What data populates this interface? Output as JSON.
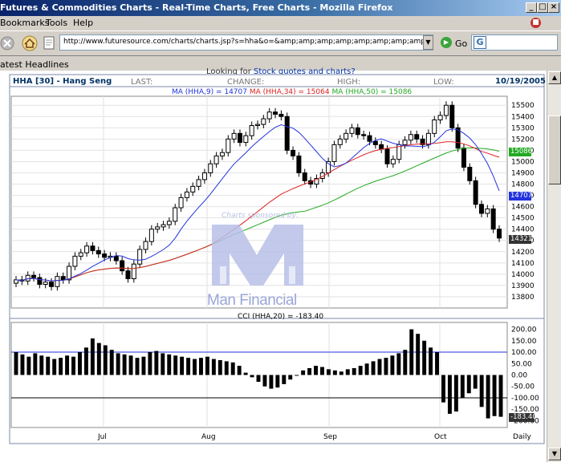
{
  "window": {
    "title": "Futures & Commodities Charts - Real-Time Charts, Free Charts - Mozilla Firefox"
  },
  "menu": {
    "bookmarks": "Bookmarks",
    "tools": "Tools",
    "help": "Help"
  },
  "nav": {
    "url": "http://www.futuresource.com/charts/charts.jsp?s=hha&o=&amp;amp;amp;amp;amp;amp;amp;amp;amp;a=D&a",
    "go_label": "Go"
  },
  "headlines": {
    "label": "atest Headlines"
  },
  "page": {
    "looking_prefix": "Looking for ",
    "looking_link": "Stock quotes and charts?"
  },
  "chart_header": {
    "ticker": "HHA [30] - Hang Seng",
    "last": "LAST:",
    "change": "CHANGE:",
    "high": "HIGH:",
    "low": "LOW:",
    "date": "10/19/2005",
    "ma9": "MA (HHA,9) = 14707",
    "ma34": "MA (HHA,34) = 15064",
    "ma50": "MA (HHA,50) = 15086"
  },
  "watermark": {
    "sponsor": "Charts sponsored by:",
    "name": "Man Financial"
  },
  "value_tags": {
    "ma50_tag": "15086",
    "ma9_tag": "14707",
    "last_tag": "14321",
    "cci_tag": "-183.40"
  },
  "colors": {
    "ma9": "#2233dd",
    "ma34": "#dd2222",
    "ma50": "#22aa22",
    "cci_ref": "#2233dd",
    "header_text": "#003366"
  },
  "chart_data": [
    {
      "type": "candlestick",
      "title": "HHA [30] - Hang Seng",
      "period": "Daily",
      "x_labels": [
        "Jul",
        "Aug",
        "Sep",
        "Oct",
        "Daily"
      ],
      "y_ticks": [
        13800,
        13900,
        14000,
        14100,
        14200,
        14300,
        14400,
        14500,
        14600,
        14700,
        14800,
        14900,
        15000,
        15100,
        15200,
        15300,
        15400,
        15500
      ],
      "ylim": [
        13700,
        15580
      ],
      "series": [
        {
          "name": "MA (HHA,9)",
          "value": 14707
        },
        {
          "name": "MA (HHA,34)",
          "value": 15064
        },
        {
          "name": "MA (HHA,50)",
          "value": 15086
        }
      ],
      "closes": [
        13950,
        13940,
        13990,
        13970,
        13910,
        13930,
        13890,
        13980,
        13950,
        14070,
        14160,
        14190,
        14250,
        14210,
        14180,
        14150,
        14160,
        14120,
        14030,
        13960,
        14090,
        14220,
        14290,
        14400,
        14420,
        14440,
        14470,
        14590,
        14680,
        14730,
        14780,
        14840,
        14900,
        14980,
        15050,
        15080,
        15200,
        15250,
        15170,
        15230,
        15320,
        15330,
        15380,
        15440,
        15420,
        15400,
        15100,
        15050,
        14900,
        14830,
        14800,
        14850,
        14900,
        15000,
        15150,
        15200,
        15250,
        15300,
        15240,
        15230,
        15180,
        15150,
        15110,
        14980,
        15020,
        15150,
        15190,
        15240,
        15200,
        15150,
        15250,
        15370,
        15410,
        15500,
        15300,
        15120,
        14950,
        14830,
        14620,
        14540,
        14580,
        14400,
        14321
      ],
      "grid": true
    },
    {
      "type": "bar",
      "title": "CCI (HHA,20) = -183.40",
      "y_ticks": [
        200,
        150,
        100,
        50,
        0,
        -50,
        -100,
        -150,
        -200
      ],
      "ylim": [
        -230,
        230
      ],
      "reference_lines": [
        100,
        -100
      ],
      "values": [
        100,
        90,
        80,
        95,
        85,
        80,
        70,
        75,
        85,
        80,
        100,
        120,
        160,
        140,
        130,
        110,
        95,
        90,
        85,
        75,
        80,
        100,
        105,
        95,
        90,
        85,
        80,
        75,
        70,
        75,
        80,
        70,
        65,
        60,
        55,
        40,
        10,
        -10,
        -30,
        -50,
        -60,
        -55,
        -40,
        -20,
        0,
        20,
        30,
        40,
        35,
        25,
        20,
        15,
        25,
        30,
        40,
        50,
        60,
        70,
        75,
        85,
        95,
        110,
        200,
        180,
        150,
        120,
        100,
        -120,
        -170,
        -160,
        -100,
        -80,
        -60,
        -140,
        -190,
        -180,
        -183
      ]
    }
  ]
}
